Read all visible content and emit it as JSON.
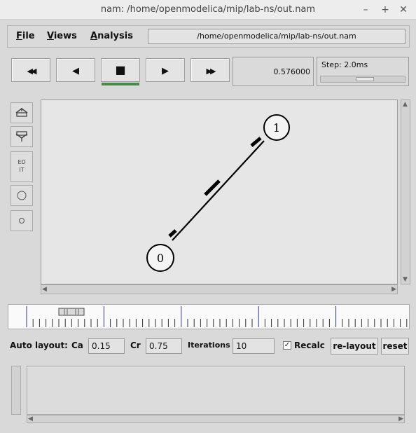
{
  "window": {
    "title": "nam: /home/openmodelica/mip/lab-ns/out.nam",
    "minimize_glyph": "–",
    "maximize_glyph": "+",
    "close_glyph": "✕"
  },
  "menubar": {
    "file_first": "F",
    "file_rest": "ile",
    "views_first": "V",
    "views_rest": "iews",
    "analysis_first": "A",
    "analysis_rest": "nalysis",
    "path": "/home/openmodelica/mip/lab-ns/out.nam"
  },
  "controls": {
    "rewind_icon": "fast-rewind-icon",
    "back_icon": "play-backward-icon",
    "stop_icon": "stop-icon",
    "play_icon": "play-forward-icon",
    "ff_icon": "fast-forward-icon",
    "rewind_glyph": "◀◀",
    "back_glyph": "◀",
    "stop_glyph": "■",
    "play_glyph": "▶",
    "ff_glyph": "▶▶",
    "time": "0.576000",
    "step_label": "Step: 2.0ms"
  },
  "tools": {
    "edit": "ED\nIT"
  },
  "topology": {
    "node0_label": "0",
    "node1_label": "1"
  },
  "autolayout": {
    "label": "Auto layout:",
    "ca_label": "Ca",
    "ca_value": "0.15",
    "cr_label": "Cr",
    "cr_value": "0.75",
    "iterations_label": "Iterations",
    "iterations_value": "10",
    "recalc_checked": "✓",
    "recalc_label": "Recalc",
    "relayout_label": "re-layout",
    "reset_label": "reset"
  },
  "colors": {
    "accent_green": "#4a8a4a"
  }
}
